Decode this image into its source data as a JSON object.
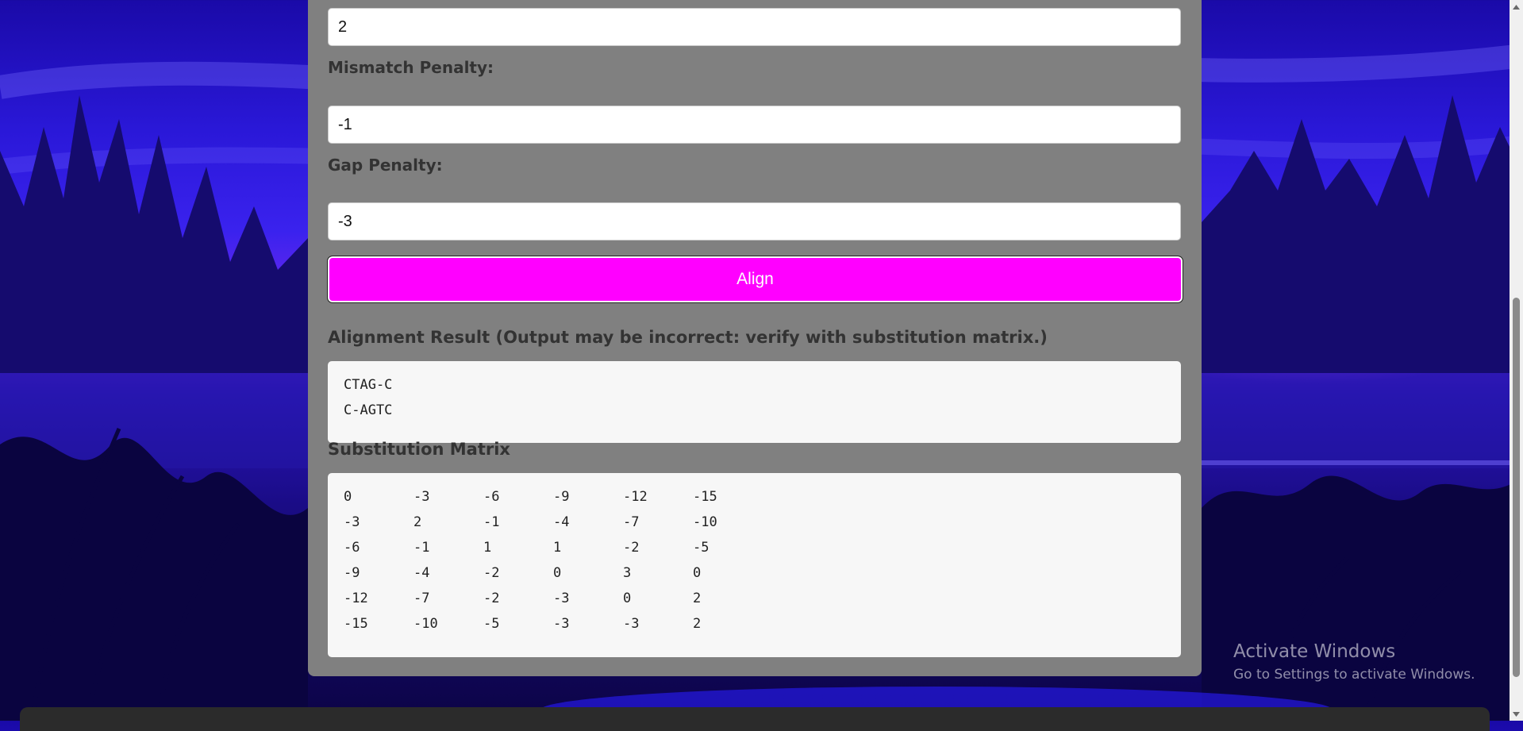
{
  "form": {
    "match_score_value": "2",
    "mismatch_label": "Mismatch Penalty:",
    "mismatch_value": "-1",
    "gap_label": "Gap Penalty:",
    "gap_value": "-3",
    "align_label": "Align"
  },
  "result": {
    "title": "Alignment Result (Output may be incorrect: verify with substitution matrix.)",
    "lines": [
      "CTAG-C",
      "C-AGTC"
    ]
  },
  "matrix": {
    "title": "Substitution Matrix",
    "rows": [
      [
        "0",
        "-3",
        "-6",
        "-9",
        "-12",
        "-15"
      ],
      [
        "-3",
        "2",
        "-1",
        "-4",
        "-7",
        "-10"
      ],
      [
        "-6",
        "-1",
        "1",
        "1",
        "-2",
        "-5"
      ],
      [
        "-9",
        "-4",
        "-2",
        "0",
        "3",
        "0"
      ],
      [
        "-12",
        "-7",
        "-2",
        "-3",
        "0",
        "2"
      ],
      [
        "-15",
        "-10",
        "-5",
        "-3",
        "-3",
        "2"
      ]
    ]
  },
  "watermark": {
    "title": "Activate Windows",
    "subtitle": "Go to Settings to activate Windows."
  },
  "colors": {
    "panel": "#808080",
    "button": "#ff00ff",
    "result_bg": "#f7f7f7"
  },
  "icons": {
    "scroll_up": "scroll-up-arrow-icon",
    "scroll_down": "scroll-down-arrow-icon"
  }
}
